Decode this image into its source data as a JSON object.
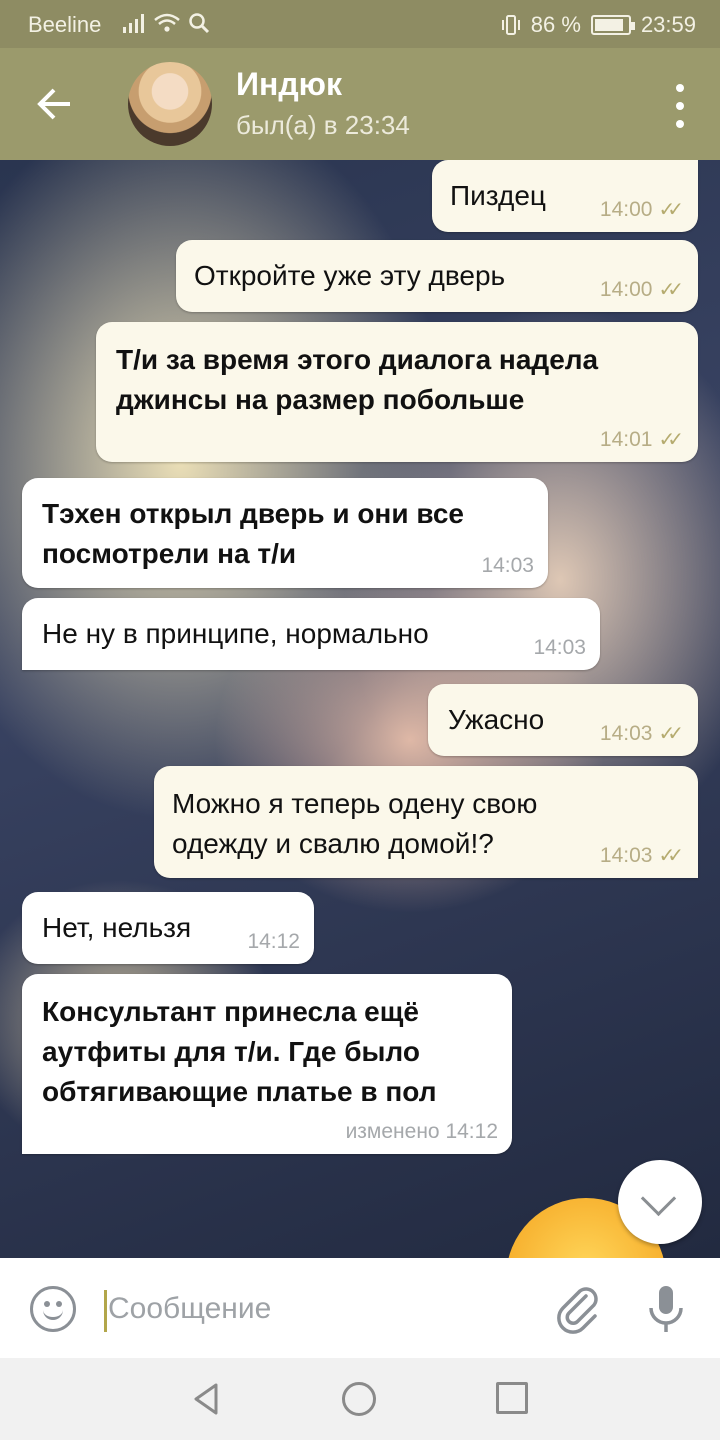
{
  "status_bar": {
    "carrier": "Beeline",
    "battery_percent": "86 %",
    "time": "23:59"
  },
  "header": {
    "contact_name": "Индюк",
    "last_seen": "был(а) в 23:34"
  },
  "messages": [
    {
      "direction": "out",
      "text": "Пиздец",
      "time": "14:00",
      "read": true
    },
    {
      "direction": "out",
      "text": "Откройте уже эту дверь",
      "time": "14:00",
      "read": true
    },
    {
      "direction": "out",
      "text": "Т/и за время этого диалога надела джинсы на размер побольше",
      "time": "14:01",
      "read": true
    },
    {
      "direction": "in",
      "text": "Тэхен открыл дверь и они все посмотрели на т/и",
      "time": "14:03"
    },
    {
      "direction": "in",
      "text": "Не ну в принципе, нормально",
      "time": "14:03"
    },
    {
      "direction": "out",
      "text": "Ужасно",
      "time": "14:03",
      "read": true
    },
    {
      "direction": "out",
      "text": "Можно я теперь одену свою одежду и свалю домой!?",
      "time": "14:03",
      "read": true
    },
    {
      "direction": "in",
      "text": "Нет, нельзя",
      "time": "14:12"
    },
    {
      "direction": "in",
      "text": "Консультант принесла ещё аутфиты для т/и. Где было обтягивающие платье в пол",
      "time": "изменено 14:12"
    }
  ],
  "input": {
    "placeholder": "Сообщение"
  },
  "icons": {
    "back": "arrow-left-icon",
    "menu": "more-vert-icon",
    "emoji": "smile-icon",
    "attach": "paperclip-icon",
    "mic": "microphone-icon",
    "scroll_down": "chevron-down-icon"
  },
  "colors": {
    "header": "#9b9a6c",
    "status_bar": "#8e8c63",
    "incoming_bubble": "#ffffff",
    "outgoing_bubble": "#fbf8ea",
    "check_marks": "#b5ab6f"
  }
}
